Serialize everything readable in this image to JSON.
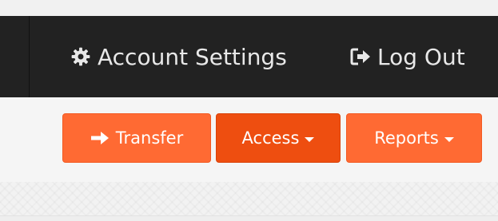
{
  "navbar": {
    "account_settings_label": "Account Settings",
    "account_settings_icon": "gear-icon",
    "logout_label": "Log Out",
    "logout_icon": "sign-out-icon",
    "background_color": "#222222",
    "text_color": "#e8e8e8"
  },
  "toolbar": {
    "transfer_label": "Transfer",
    "transfer_icon": "arrow-right-icon",
    "access_label": "Access",
    "reports_label": "Reports",
    "dropdown_icon": "caret-down-icon",
    "button_color": "#ff6a33",
    "active_button_color": "#ee4e10"
  }
}
